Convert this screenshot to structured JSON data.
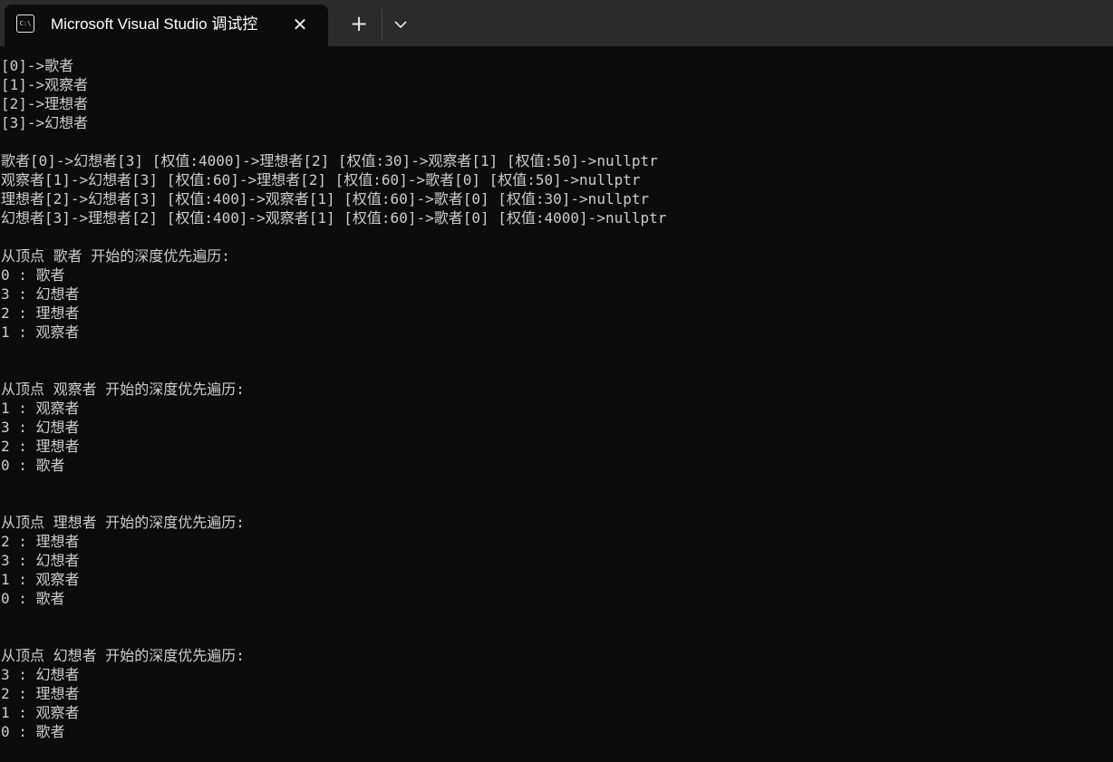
{
  "window": {
    "tab_icon_text": "C:\\",
    "tab_title": "Microsoft Visual Studio 调试控",
    "close_glyph": "✕",
    "new_tab_glyph": "+",
    "dropdown_icon": "chevron-down-icon"
  },
  "console": {
    "lines": [
      "[0]->歌者",
      "[1]->观察者",
      "[2]->理想者",
      "[3]->幻想者",
      "",
      "歌者[0]->幻想者[3] [权值:4000]->理想者[2] [权值:30]->观察者[1] [权值:50]->nullptr",
      "观察者[1]->幻想者[3] [权值:60]->理想者[2] [权值:60]->歌者[0] [权值:50]->nullptr",
      "理想者[2]->幻想者[3] [权值:400]->观察者[1] [权值:60]->歌者[0] [权值:30]->nullptr",
      "幻想者[3]->理想者[2] [权值:400]->观察者[1] [权值:60]->歌者[0] [权值:4000]->nullptr",
      "",
      "从顶点 歌者 开始的深度优先遍历:",
      "0 : 歌者",
      "3 : 幻想者",
      "2 : 理想者",
      "1 : 观察者",
      "",
      "",
      "从顶点 观察者 开始的深度优先遍历:",
      "1 : 观察者",
      "3 : 幻想者",
      "2 : 理想者",
      "0 : 歌者",
      "",
      "",
      "从顶点 理想者 开始的深度优先遍历:",
      "2 : 理想者",
      "3 : 幻想者",
      "1 : 观察者",
      "0 : 歌者",
      "",
      "",
      "从顶点 幻想者 开始的深度优先遍历:",
      "3 : 幻想者",
      "2 : 理想者",
      "1 : 观察者",
      "0 : 歌者"
    ]
  },
  "colors": {
    "background": "#0c0c0c",
    "tabbar": "#2b2b2b",
    "text": "#cccccc"
  }
}
